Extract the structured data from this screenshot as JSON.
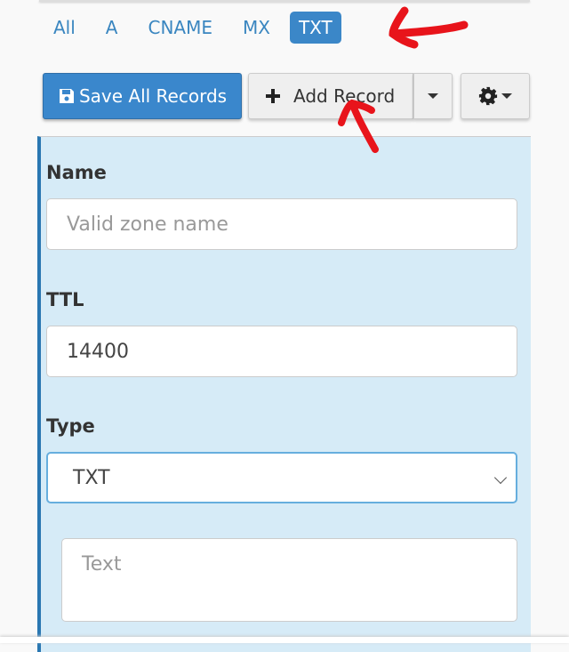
{
  "filters": [
    {
      "label": "All",
      "active": false
    },
    {
      "label": "A",
      "active": false
    },
    {
      "label": "CNAME",
      "active": false
    },
    {
      "label": "MX",
      "active": false
    },
    {
      "label": "TXT",
      "active": true
    }
  ],
  "toolbar": {
    "save_label": "Save All Records",
    "add_label": "Add Record",
    "save_icon": "floppy-disk-icon",
    "add_icon": "plus-icon",
    "settings_icon": "gear-icon"
  },
  "form": {
    "name_label": "Name",
    "name_placeholder": "Valid zone name",
    "ttl_label": "TTL",
    "ttl_value": "14400",
    "type_label": "Type",
    "type_value": "TXT",
    "text_placeholder": "Text"
  },
  "colors": {
    "accent": "#3a87cc",
    "panel": "#d6ebf7",
    "annotation": "#e8141b"
  }
}
